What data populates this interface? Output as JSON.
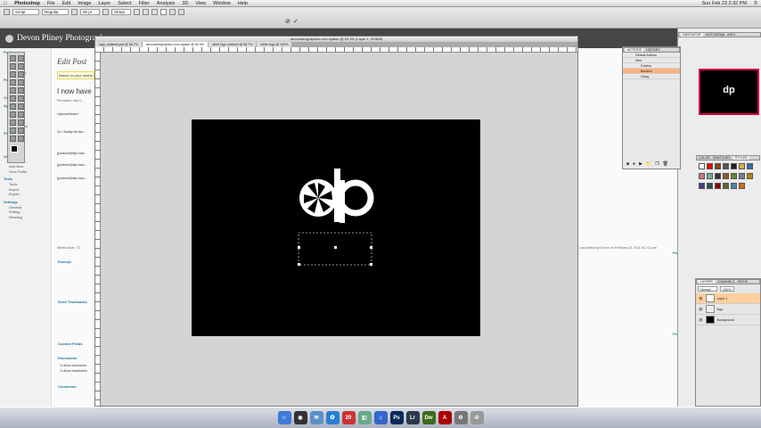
{
  "menubar": {
    "app": "Photoshop",
    "items": [
      "File",
      "Edit",
      "Image",
      "Layer",
      "Select",
      "Filter",
      "Analysis",
      "3D",
      "View",
      "Window",
      "Help"
    ],
    "clock": "Sun Feb 23  2:32 PM"
  },
  "options": {
    "font_family": "Script",
    "font_style": "Regular",
    "font_size": "65 pt",
    "antialias": "Sharp"
  },
  "wp": {
    "site_title": "Devon Pliney Photography",
    "edit_heading": "Edit Post",
    "notice": "Based on your dashb...",
    "post_title": "I now have",
    "permalink": "Permalink: http://...",
    "upload_label": "Upload/Insert",
    "body_lines": [
      "So I finally bit the...",
      "[youtube]http://ww...",
      "[youtube]http://ww...",
      "[youtube]http://ww..."
    ],
    "word_count": "Word count: 72",
    "excerpt": "Excerpt",
    "send_trackbacks": "Send Trackbacks",
    "custom_fields": "Custom Fields",
    "discussion": "Discussion",
    "allow_comments": "Allow comments",
    "allow_trackbacks": "Allow trackbacks",
    "comments": "Comments",
    "last_edited": "Last edited by Devon on February 20, 2011 at 2:12 pm",
    "post_tags": "Post Tags",
    "featured_image": "Featured Image"
  },
  "sidebar": {
    "sections": [
      {
        "label": "Posts",
        "items": [
          "Edit",
          "Add New",
          "Post Tags",
          "Categories"
        ]
      },
      {
        "label": "Pages",
        "items": [
          "Edit",
          "Add New"
        ]
      },
      {
        "label": "Comments",
        "items": []
      },
      {
        "label": "Appearance",
        "items": [
          "Themes",
          "Widgets",
          "Editor",
          "Background"
        ]
      },
      {
        "label": "Plugins",
        "items": [
          "Installed",
          "Add New",
          "Editor"
        ]
      },
      {
        "label": "Users",
        "items": [
          "Authors",
          "Add New",
          "Your Profile"
        ]
      },
      {
        "label": "Tools",
        "items": [
          "Tools",
          "Import",
          "Export"
        ]
      },
      {
        "label": "Settings",
        "items": [
          "General",
          "Writing",
          "Reading"
        ]
      }
    ]
  },
  "document": {
    "window_title": "devonwiregraphics.com splash @ 83.3% (Layer 1, RGB/8)",
    "tabs": [
      "logo_outlined.psd @ 66.7%",
      "devonwiregraphics.com splash @ 83.3%",
      "other logo outlined @ 66.7%",
      "white logo @ 100%"
    ],
    "active_tab": 1,
    "logo_text": "dp"
  },
  "actions": {
    "tabs": [
      "ACTIONS",
      "HISTORY"
    ],
    "rows": [
      "Default Actions",
      "Wire",
      "Folders",
      "Borders",
      "Delay"
    ],
    "highlighted_row": 3
  },
  "navigator": {
    "tabs": [
      "NAVIGATOR",
      "HISTOGRAM",
      "INFO"
    ]
  },
  "swatches": {
    "tabs": [
      "COLOR",
      "SWATCHES",
      "STYLES"
    ],
    "colors": [
      "#ffffff",
      "#ff0000",
      "#8b4513",
      "#555555",
      "#222222",
      "#d8b04a",
      "#3a6ea5",
      "#c77",
      "#7aa",
      "#333",
      "#a0522d",
      "#6b8e23",
      "#708090",
      "#b8860b",
      "#483d8b",
      "#2f4f4f",
      "#8b0000",
      "#556b2f",
      "#4682b4",
      "#d2691e"
    ]
  },
  "layers": {
    "tabs": [
      "LAYERS",
      "CHANNELS",
      "PATHS"
    ],
    "blend": "Normal",
    "opacity": "100%",
    "rows": [
      {
        "name": "Layer 1",
        "selected": true
      },
      {
        "name": "logo",
        "selected": false
      },
      {
        "name": "Background",
        "selected": false
      }
    ]
  },
  "dock": {
    "icons": [
      {
        "name": "finder",
        "color": "#3b7bd6",
        "glyph": "☺"
      },
      {
        "name": "dashboard",
        "color": "#333",
        "glyph": "◉"
      },
      {
        "name": "mail",
        "color": "#5d8fc9",
        "glyph": "✉"
      },
      {
        "name": "safari",
        "color": "#2a7fd4",
        "glyph": "✪"
      },
      {
        "name": "ical",
        "color": "#c33",
        "glyph": "20"
      },
      {
        "name": "preview",
        "color": "#6a8",
        "glyph": "◧"
      },
      {
        "name": "itunes",
        "color": "#36c",
        "glyph": "♫"
      },
      {
        "name": "photoshop",
        "color": "#0a2a5a",
        "glyph": "Ps"
      },
      {
        "name": "lightroom",
        "color": "#2b3a4a",
        "glyph": "Lr"
      },
      {
        "name": "dreamweaver",
        "color": "#3a6b1a",
        "glyph": "Dw"
      },
      {
        "name": "acrobat",
        "color": "#a00",
        "glyph": "A"
      },
      {
        "name": "system-prefs",
        "color": "#777",
        "glyph": "⚙"
      },
      {
        "name": "trash",
        "color": "#999",
        "glyph": "♲"
      }
    ]
  }
}
